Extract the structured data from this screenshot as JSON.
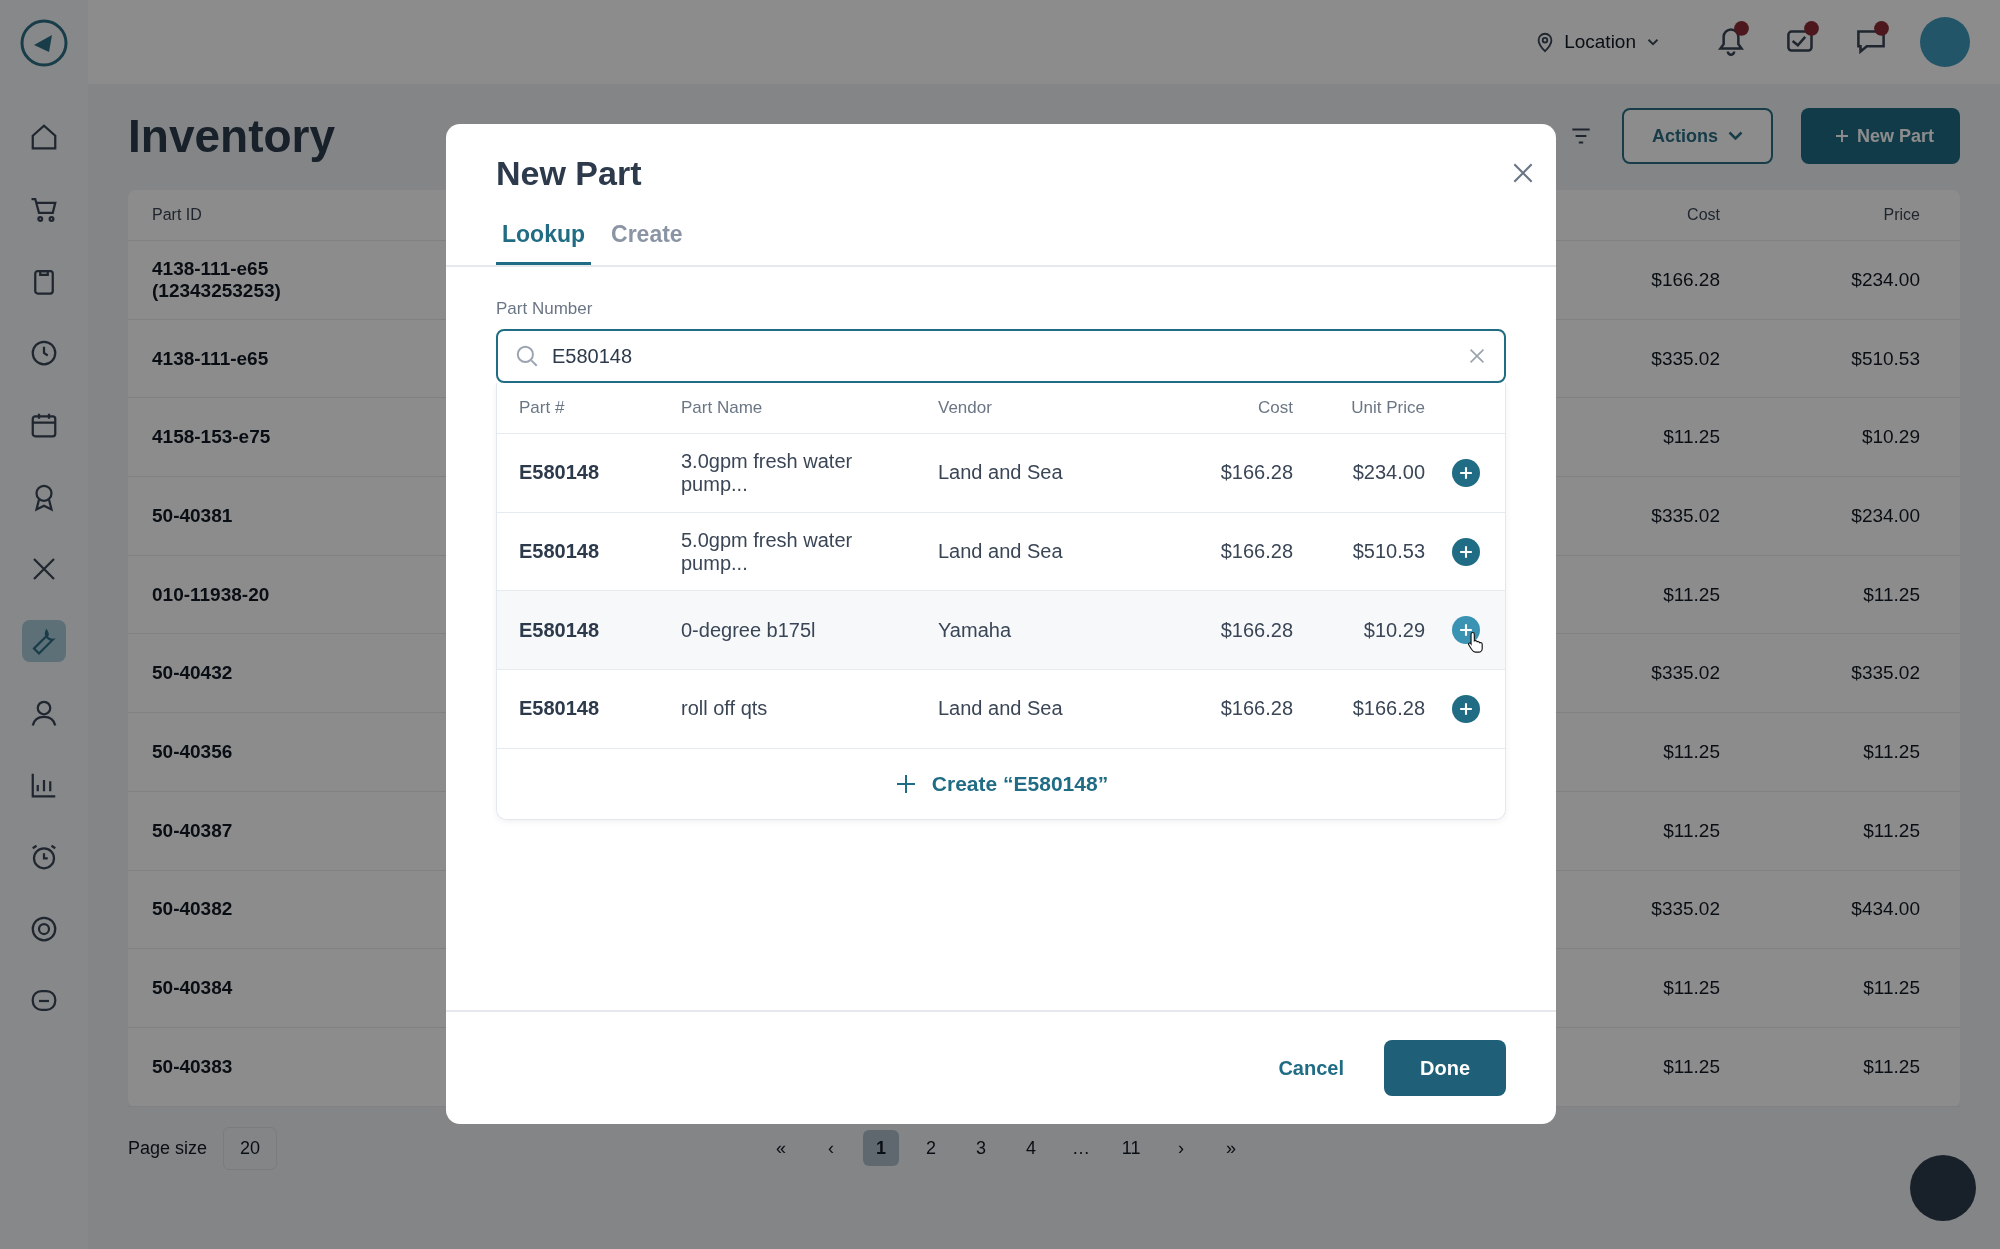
{
  "sidebar": {
    "items": [
      {
        "selected": false
      },
      {
        "selected": false
      },
      {
        "selected": false
      },
      {
        "selected": false
      },
      {
        "selected": false
      },
      {
        "selected": false
      },
      {
        "selected": false
      },
      {
        "selected": true
      },
      {
        "selected": false
      },
      {
        "selected": false
      },
      {
        "selected": false
      },
      {
        "selected": false
      },
      {
        "selected": false
      }
    ]
  },
  "header": {
    "location": "Location"
  },
  "page": {
    "title": "Inventory",
    "actions": "Actions",
    "new_part": "New Part",
    "table": {
      "columns": [
        "Part ID",
        "Cost",
        "Price"
      ],
      "rows": [
        {
          "part_id": "4138-111-e65 (12343253253)",
          "cost": "$166.28",
          "price": "$234.00"
        },
        {
          "part_id": "4138-111-e65",
          "cost": "$335.02",
          "price": "$510.53"
        },
        {
          "part_id": "4158-153-e75",
          "cost": "$11.25",
          "price": "$10.29"
        },
        {
          "part_id": "50-40381",
          "cost": "$335.02",
          "price": "$234.00"
        },
        {
          "part_id": "010-11938-20",
          "cost": "$11.25",
          "price": "$11.25"
        },
        {
          "part_id": "50-40432",
          "cost": "$335.02",
          "price": "$335.02"
        },
        {
          "part_id": "50-40356",
          "cost": "$11.25",
          "price": "$11.25"
        },
        {
          "part_id": "50-40387",
          "cost": "$11.25",
          "price": "$11.25"
        },
        {
          "part_id": "50-40382",
          "cost": "$335.02",
          "price": "$434.00"
        },
        {
          "part_id": "50-40384",
          "cost": "$11.25",
          "price": "$11.25"
        },
        {
          "part_id": "50-40383",
          "cost": "$11.25",
          "price": "$11.25"
        }
      ]
    },
    "pagination": {
      "page_size_label": "Page size",
      "page_size": "20",
      "first": "«",
      "prev": "‹",
      "next": "›",
      "last": "»",
      "pages": [
        {
          "label": "1",
          "selected": true
        },
        {
          "label": "2",
          "selected": false
        },
        {
          "label": "3",
          "selected": false
        },
        {
          "label": "4",
          "selected": false
        },
        {
          "label": "…",
          "selected": false
        },
        {
          "label": "11",
          "selected": false
        }
      ]
    }
  },
  "modal": {
    "title": "New Part",
    "tabs": [
      {
        "label": "Lookup",
        "selected": true
      },
      {
        "label": "Create",
        "selected": false
      }
    ],
    "field": {
      "label": "Part Number",
      "value": "E580148"
    },
    "results": {
      "columns": [
        "Part #",
        "Part Name",
        "Vendor",
        "Cost",
        "Unit Price"
      ],
      "rows": [
        {
          "part": "E580148",
          "name": "3.0gpm fresh water pump...",
          "vendor": "Land and Sea",
          "cost": "$166.28",
          "unit_price": "$234.00",
          "highlighted": false
        },
        {
          "part": "E580148",
          "name": "5.0gpm fresh water pump...",
          "vendor": "Land and Sea",
          "cost": "$166.28",
          "unit_price": "$510.53",
          "highlighted": false
        },
        {
          "part": "E580148",
          "name": "0-degree b175l",
          "vendor": "Yamaha",
          "cost": "$166.28",
          "unit_price": "$10.29",
          "highlighted": true
        },
        {
          "part": "E580148",
          "name": "roll off qts",
          "vendor": "Land and Sea",
          "cost": "$166.28",
          "unit_price": "$166.28",
          "highlighted": false
        }
      ],
      "create": "Create “E580148”"
    },
    "buttons": {
      "cancel": "Cancel",
      "done": "Done"
    }
  }
}
